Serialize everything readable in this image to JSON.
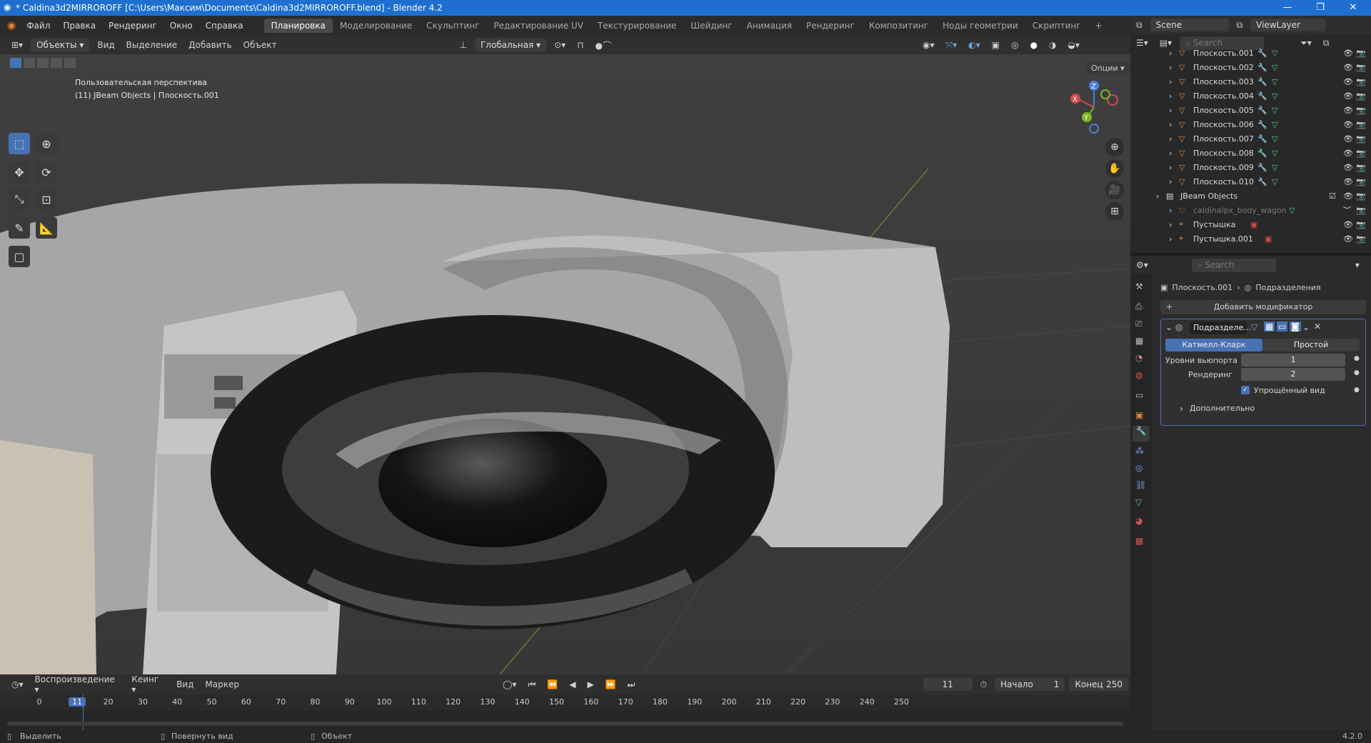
{
  "app": {
    "title": "* Caldina3d2MIRROROFF [C:\\Users\\Максим\\Documents\\Caldina3d2MIRROROFF.blend] - Blender 4.2"
  },
  "menu": [
    "Файл",
    "Правка",
    "Рендеринг",
    "Окно",
    "Справка"
  ],
  "workspaces": [
    "Планировка",
    "Моделирование",
    "Скульптинг",
    "Редактирование UV",
    "Текстурирование",
    "Шейдинг",
    "Анимация",
    "Рендеринг",
    "Композитинг",
    "Ноды геометрии",
    "Скриптинг"
  ],
  "active_workspace": "Планировка",
  "scene": {
    "label": "Scene",
    "viewlayer": "ViewLayer"
  },
  "header3d": {
    "mode": "Объекты",
    "items": [
      "Вид",
      "Выделение",
      "Добавить",
      "Объект"
    ],
    "orientation": "Глобальная",
    "options": "Опции"
  },
  "viewport": {
    "line1": "Пользовательская перспектива",
    "line2": "(11) JBeam Objects | Плоскость.001",
    "gizmo": {
      "x": "X",
      "y": "Y",
      "z": "Z"
    }
  },
  "outliner": {
    "search_placeholder": "Search",
    "rows": [
      "Плоскость.001",
      "Плоскость.002",
      "Плоскость.003",
      "Плоскость.004",
      "Плоскость.005",
      "Плоскость.006",
      "Плоскость.007",
      "Плоскость.008",
      "Плоскость.009",
      "Плоскость.010"
    ],
    "collection": "JBeam Objects",
    "sub": [
      "caldinalpx_body_wagon",
      "Пустышка",
      "Пустышка.001"
    ]
  },
  "properties": {
    "search_placeholder": "Search",
    "breadcrumb_object": "Плоскость.001",
    "breadcrumb_mod": "Подразделения",
    "add_modifier": "Добавить модификатор",
    "modifier_name": "Подразделе...",
    "tab_active": "Катмелл-Кларк",
    "tab_other": "Простой",
    "viewport_label": "Уровни вьюпорта",
    "viewport_value": "1",
    "render_label": "Рендеринг",
    "render_value": "2",
    "simplified": "Упрощённый вид",
    "advanced": "Дополнительно"
  },
  "timeline": {
    "items": [
      "Воспроизведение",
      "Кеинг",
      "Вид",
      "Маркер"
    ],
    "current_frame": "11",
    "start_label": "Начало",
    "start": "1",
    "end_label": "Конец",
    "end": "250",
    "ticks": [
      "0",
      "11",
      "20",
      "30",
      "40",
      "50",
      "60",
      "70",
      "80",
      "90",
      "100",
      "110",
      "120",
      "130",
      "140",
      "150",
      "160",
      "170",
      "180",
      "190",
      "200",
      "210",
      "220",
      "230",
      "240",
      "250"
    ]
  },
  "status": {
    "select": "Выделить",
    "rotate": "Повернуть вид",
    "object": "Объект",
    "version": "4.2.0"
  },
  "colors": {
    "accent": "#4772b3",
    "titlebar": "#1e6fd0",
    "mesh_icon": "#e1883a",
    "modifier_icon": "#6ea3e6",
    "data_icon": "#4fd07a"
  }
}
